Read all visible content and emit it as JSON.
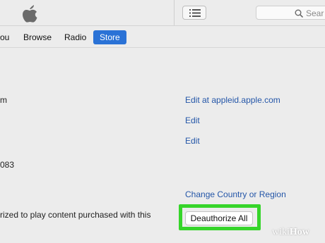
{
  "header": {
    "logo_icon": "apple-logo-icon",
    "list_icon": "list-view-icon",
    "search_icon": "magnifier-icon",
    "search_placeholder": "Sear"
  },
  "nav": {
    "items": [
      {
        "label": "You",
        "visible_text": "ou"
      },
      {
        "label": "Browse"
      },
      {
        "label": "Radio"
      },
      {
        "label": "Store",
        "selected": true
      }
    ],
    "accent": "#2a72d6"
  },
  "account": {
    "rows": [
      {
        "label_fragment": "m",
        "action": "Edit at appleid.apple.com"
      },
      {
        "action": "Edit"
      },
      {
        "action": "Edit"
      },
      {
        "label_fragment": "083"
      },
      {
        "action": "Change Country or Region"
      },
      {
        "label_fragment": "rized to play content purchased with this",
        "button": "Deauthorize All"
      }
    ],
    "link_color": "#2456a8"
  },
  "highlight": {
    "color": "#36d52a"
  },
  "watermark": {
    "part1": "wiki",
    "part2": "How"
  }
}
